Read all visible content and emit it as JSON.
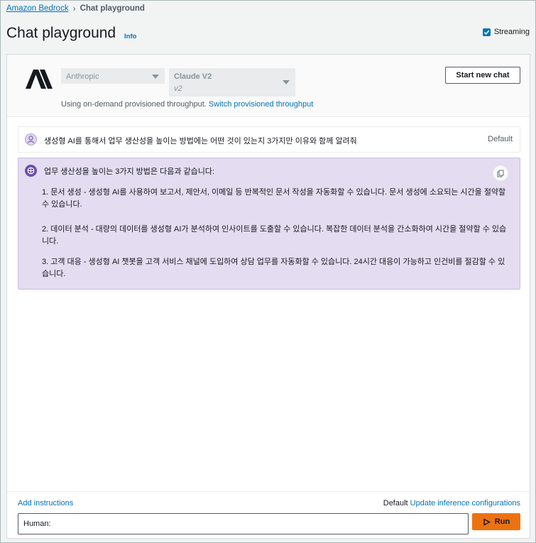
{
  "breadcrumb": {
    "root": "Amazon Bedrock",
    "current": "Chat playground"
  },
  "header": {
    "title": "Chat playground",
    "info": "Info",
    "streaming_label": "Streaming",
    "streaming_checked": true
  },
  "model": {
    "provider": "Anthropic",
    "model_name": "Claude V2",
    "model_version": "v2",
    "throughput_text": "Using on-demand provisioned throughput.",
    "throughput_link": "Switch provisioned throughput",
    "new_chat_label": "Start new chat"
  },
  "messages": {
    "user": {
      "text": "생성형 AI를 통해서 업무 생산성을 높이는 방법에는 어떤 것이 있는지 3가지만 이유와 함께 알려줘",
      "tag": "Default"
    },
    "assistant": {
      "intro": "업무 생산성을 높이는 3가지 방법은 다음과 같습니다:",
      "points": [
        "1. 문서 생성 - 생성형 AI를 사용하여 보고서, 제안서, 이메일 등 반복적인 문서 작성을 자동화할 수 있습니다. 문서 생성에 소요되는 시간을 절약할 수 있습니다.",
        "2. 데이터 분석 - 대량의 데이터를 생성형 AI가 분석하여 인사이트를 도출할 수 있습니다. 복잡한 데이터 분석을 간소화하여 시간을 절약할 수 있습니다.",
        "3. 고객 대응 - 생성형 AI 챗봇을 고객 서비스 채널에 도입하여 상담 업무를 자동화할 수 있습니다. 24시간 대응이 가능하고 인건비를 절감할 수 있습니다."
      ]
    }
  },
  "footer": {
    "add_instructions": "Add instructions",
    "config_default": "Default",
    "config_link": "Update inference configurations",
    "input_value": "Human:",
    "run_label": "Run"
  },
  "colors": {
    "accent": "#0073bb",
    "run": "#ec7211",
    "assistant_bg": "#e4dcf0"
  }
}
